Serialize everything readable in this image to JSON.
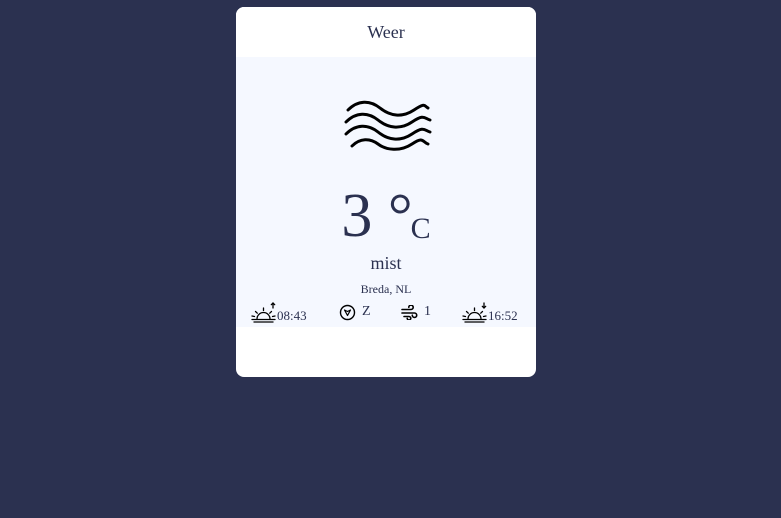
{
  "widget": {
    "title": "Weer",
    "condition_icon": "mist-icon",
    "temperature": "3 °",
    "unit": "C",
    "condition": "mist",
    "location": "Breda, NL",
    "sunrise": "08:43",
    "wind_direction": "Z",
    "wind_speed": "1",
    "sunset": "16:52"
  },
  "colors": {
    "page_background": "#2b3150",
    "card_background": "#ffffff",
    "body_background": "#f5f8ff",
    "text": "#2b3150"
  }
}
